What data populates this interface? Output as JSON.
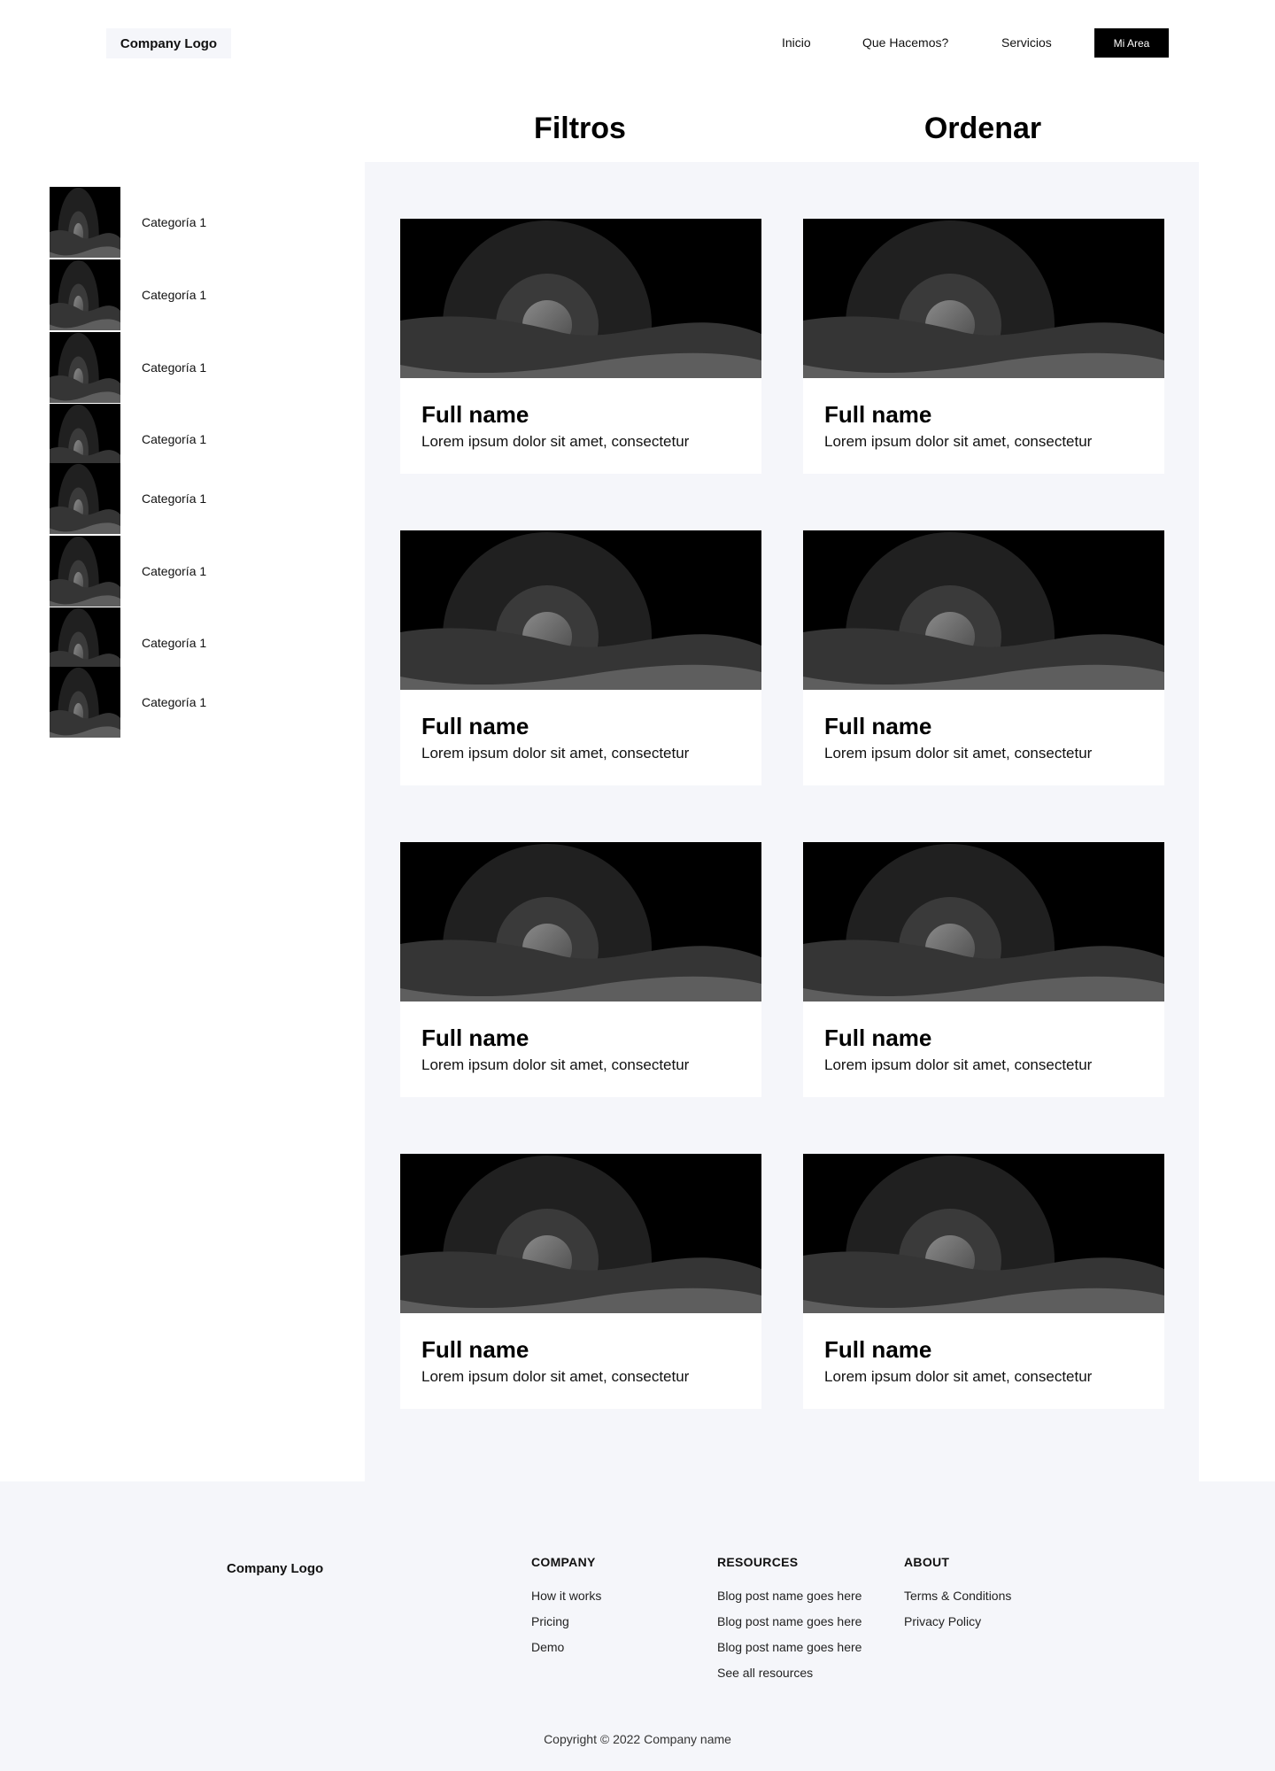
{
  "header": {
    "logo": "Company Logo",
    "nav": [
      "Inicio",
      "Que Hacemos?",
      "Servicios"
    ],
    "cta": "Mi Area"
  },
  "headings": {
    "filters": "Filtros",
    "sort": "Ordenar"
  },
  "sidebar": {
    "categories": [
      {
        "label": "Categoría 1",
        "icon": "image-placeholder-icon"
      },
      {
        "label": "Categoría 1",
        "icon": "image-placeholder-icon"
      },
      {
        "label": "Categoría 1",
        "icon": "image-placeholder-icon"
      },
      {
        "label": "Categoría 1",
        "icon": "image-placeholder-icon"
      },
      {
        "label": "Categoría 1",
        "icon": "image-placeholder-icon"
      },
      {
        "label": "Categoría 1",
        "icon": "image-placeholder-icon"
      },
      {
        "label": "Categoría 1",
        "icon": "image-placeholder-icon"
      },
      {
        "label": "Categoría 1",
        "icon": "image-placeholder-icon"
      }
    ]
  },
  "cards": [
    {
      "title": "Full name",
      "desc": "Lorem ipsum dolor sit amet, consectetur"
    },
    {
      "title": "Full name",
      "desc": "Lorem ipsum dolor sit amet, consectetur"
    },
    {
      "title": "Full name",
      "desc": "Lorem ipsum dolor sit amet, consectetur"
    },
    {
      "title": "Full name",
      "desc": "Lorem ipsum dolor sit amet, consectetur"
    },
    {
      "title": "Full name",
      "desc": "Lorem ipsum dolor sit amet, consectetur"
    },
    {
      "title": "Full name",
      "desc": "Lorem ipsum dolor sit amet, consectetur"
    },
    {
      "title": "Full name",
      "desc": "Lorem ipsum dolor sit amet, consectetur"
    },
    {
      "title": "Full name",
      "desc": "Lorem ipsum dolor sit amet, consectetur"
    }
  ],
  "footer": {
    "logo": "Company Logo",
    "columns": [
      {
        "title": "COMPANY",
        "links": [
          "How it works",
          "Pricing",
          "Demo"
        ]
      },
      {
        "title": "RESOURCES",
        "links": [
          "Blog post name goes here",
          "Blog post name goes here",
          "Blog post name goes here",
          "See all resources"
        ]
      },
      {
        "title": "ABOUT",
        "links": [
          "Terms & Conditions",
          "Privacy Policy"
        ]
      }
    ],
    "copyright": "Copyright © 2022 Company name"
  },
  "colors": {
    "background": "#ffffff",
    "panel": "#f5f6fa",
    "button": "#000000",
    "button_text": "#ffffff"
  }
}
